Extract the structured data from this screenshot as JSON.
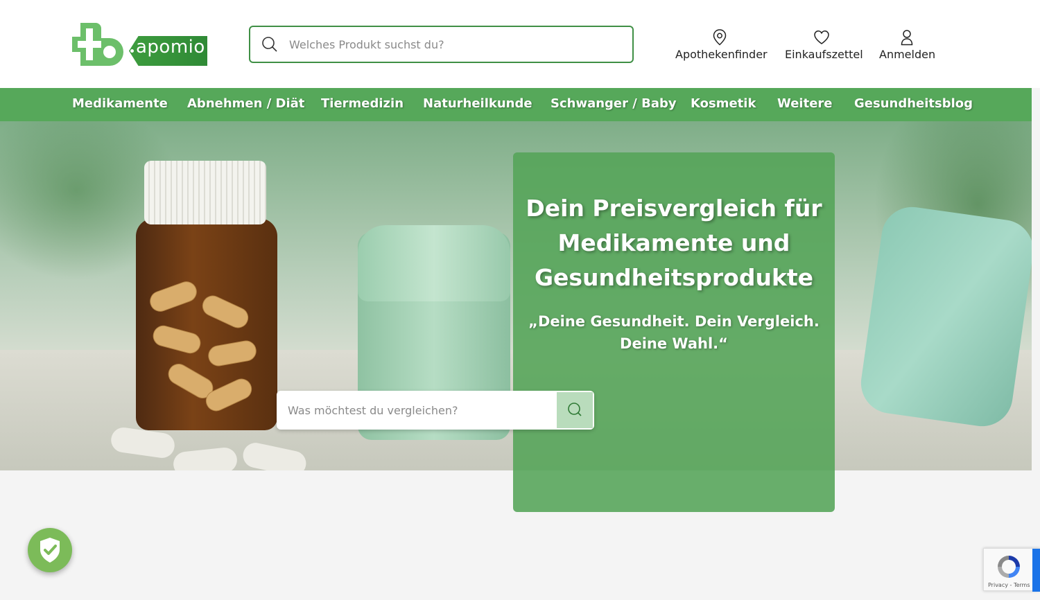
{
  "header": {
    "logo_text": "apomio",
    "search_placeholder": "Welches Produkt suchst du?",
    "nav": [
      {
        "label": "Apothekenfinder",
        "icon": "location-pin-icon"
      },
      {
        "label": "Einkaufszettel",
        "icon": "heart-icon"
      },
      {
        "label": "Anmelden",
        "icon": "user-icon"
      }
    ]
  },
  "menu": {
    "items": [
      "Medikamente",
      "Abnehmen / Diät",
      "Tiermedizin",
      "Naturheilkunde",
      "Schwanger / Baby",
      "Kosmetik",
      "Weitere",
      "Gesundheitsblog"
    ]
  },
  "hero": {
    "title": "Dein Preisvergleich für Medikamente und Gesundheitsprodukte",
    "subtitle": "„Deine Gesundheit. Dein Vergleich. Deine Wahl.“",
    "search_placeholder": "Was möchtest du vergleichen?"
  },
  "recaptcha": {
    "terms": "Privacy - Terms"
  },
  "colors": {
    "brand_green": "#56a85a",
    "search_border": "#3f8f45",
    "shield_green": "#7cbb59"
  }
}
